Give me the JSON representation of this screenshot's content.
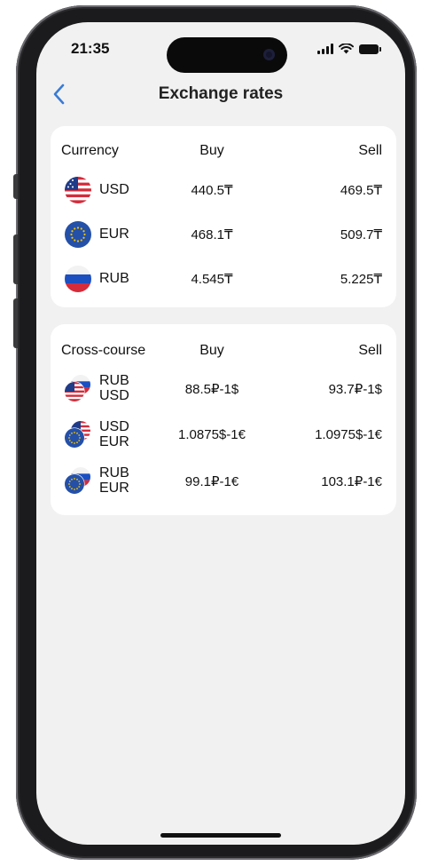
{
  "status_bar": {
    "time": "21:35"
  },
  "header": {
    "title": "Exchange rates",
    "back_icon": "chevron-left-icon"
  },
  "colors": {
    "accent": "#3a7bd5",
    "background": "#f1f1f1",
    "card": "#ffffff"
  },
  "rates_table": {
    "headers": {
      "currency": "Currency",
      "buy": "Buy",
      "sell": "Sell"
    },
    "rows": [
      {
        "code": "USD",
        "flag": "us-flag-icon",
        "buy": "440.5₸",
        "sell": "469.5₸"
      },
      {
        "code": "EUR",
        "flag": "eu-flag-icon",
        "buy": "468.1₸",
        "sell": "509.7₸"
      },
      {
        "code": "RUB",
        "flag": "ru-flag-icon",
        "buy": "4.545₸",
        "sell": "5.225₸"
      }
    ]
  },
  "cross_table": {
    "headers": {
      "pair": "Cross-course",
      "buy": "Buy",
      "sell": "Sell"
    },
    "rows": [
      {
        "top": "RUB",
        "bottom": "USD",
        "buy": "88.5₽-1$",
        "sell": "93.7₽-1$"
      },
      {
        "top": "USD",
        "bottom": "EUR",
        "buy": "1.0875$-1€",
        "sell": "1.0975$-1€"
      },
      {
        "top": "RUB",
        "bottom": "EUR",
        "buy": "99.1₽-1€",
        "sell": "103.1₽-1€"
      }
    ]
  }
}
